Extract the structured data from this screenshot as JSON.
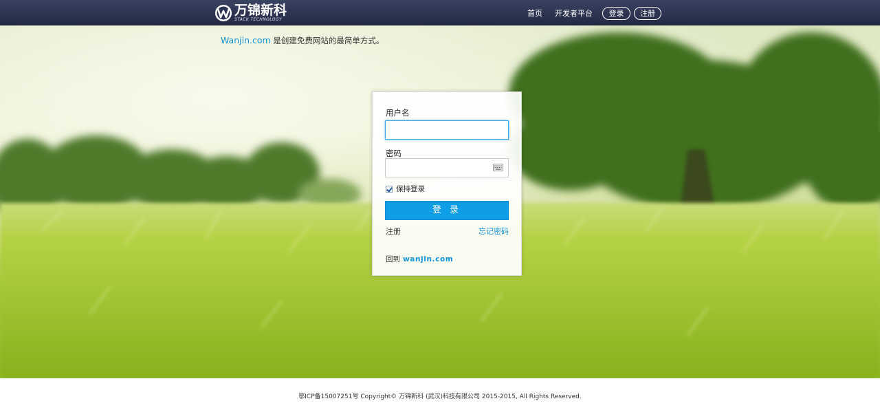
{
  "header": {
    "logo_cn": "万锦新科",
    "logo_en": "STACK TECHNOLOGY",
    "nav": {
      "home": "首页",
      "developer": "开发者平台",
      "login": "登录",
      "register": "注册"
    }
  },
  "tagline": {
    "brand": "Wanjin.com",
    "text": " 是创建免费网站的最简单方式。"
  },
  "login_form": {
    "username_label": "用户名",
    "username_value": "",
    "password_label": "密码",
    "password_value": "",
    "remember_label": "保持登录",
    "remember_checked": true,
    "submit_label": "登 录",
    "register_link": "注册",
    "forgot_link": "忘记密码",
    "back_prefix": "回到",
    "back_link": "wanjin.com"
  },
  "footer": {
    "text": "鄂ICP备15007251号 Copyright© 万锦新科 (武汉)科技有限公司 2015-2015, All Rights Reserved."
  },
  "icons": {
    "logo": "wanjin-w-logo-icon",
    "keyboard": "keyboard-icon",
    "checkbox": "checkmark-icon"
  },
  "colors": {
    "navbar": "#2b3150",
    "accent": "#0f9de6",
    "link": "#1592d6"
  }
}
